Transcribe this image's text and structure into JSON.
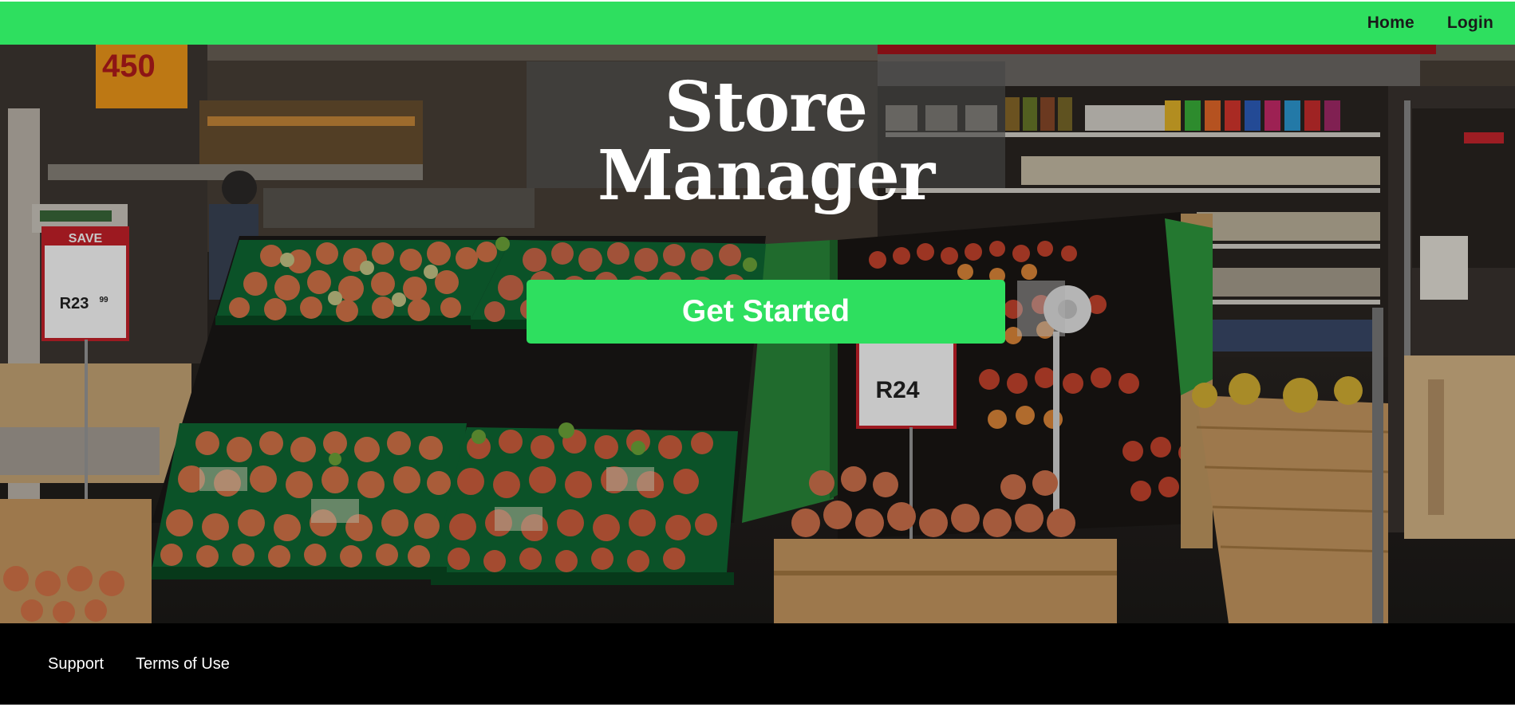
{
  "nav": {
    "home_label": "Home",
    "login_label": "Login"
  },
  "hero": {
    "title": "Store Manager",
    "cta_label": "Get Started",
    "background_image": "supermarket-produce-aisle",
    "signage": {
      "promo_number": "450",
      "save_label": "SAVE",
      "price_left": "R23",
      "price_left_cents": "99",
      "price_right": "R24"
    }
  },
  "footer": {
    "support_label": "Support",
    "terms_label": "Terms of Use"
  },
  "colors": {
    "accent_green": "#2edf5f",
    "footer_bg": "#000000",
    "nav_text": "#1a1a1a",
    "title_text": "#ffffff"
  }
}
